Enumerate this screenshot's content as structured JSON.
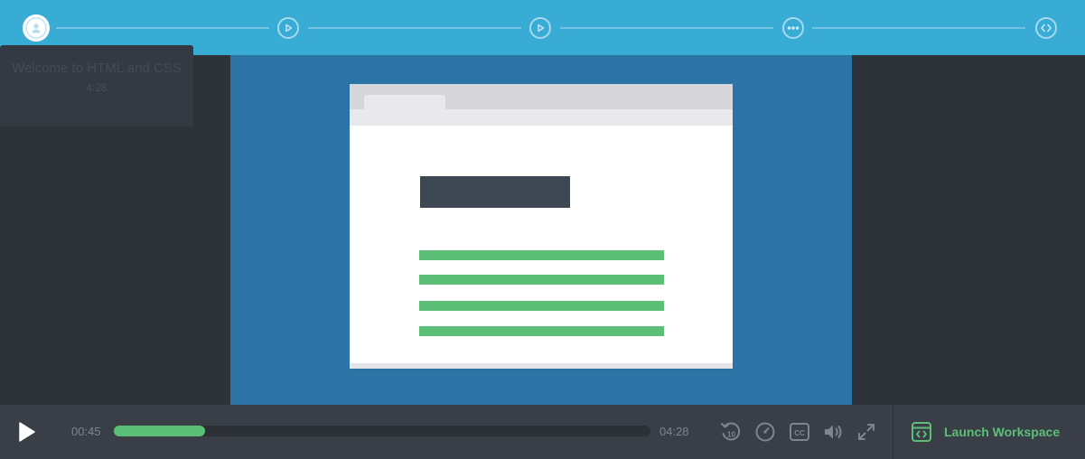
{
  "track": {
    "steps": [
      {
        "name": "step-current",
        "icon": "avatar-icon",
        "state": "current"
      },
      {
        "name": "step-video-2",
        "icon": "play-circle-icon",
        "state": "upcoming"
      },
      {
        "name": "step-video-3",
        "icon": "play-circle-icon",
        "state": "upcoming"
      },
      {
        "name": "step-quiz",
        "icon": "quiz-dots-icon",
        "state": "upcoming"
      },
      {
        "name": "step-code-challenge",
        "icon": "code-icon",
        "state": "upcoming"
      }
    ]
  },
  "tooltip": {
    "title": "Welcome to HTML and CSS",
    "meta": "4:28"
  },
  "player": {
    "current_time": "00:45",
    "duration": "04:28",
    "progress_fraction": 0.17,
    "icons": [
      "play-icon",
      "rewind-10-icon",
      "speed-gauge-icon",
      "closed-captions-icon",
      "volume-icon",
      "fullscreen-icon"
    ],
    "rewind_label": "10",
    "cc_label": "CC"
  },
  "workspace": {
    "label": "Launch Workspace",
    "icon": "workspace-icon"
  },
  "colors": {
    "track": "#39acd6",
    "video_bg": "#2c74a6",
    "accent_green": "#5bbf78",
    "control_bar": "#3a3f47",
    "page_bg": "#2e3239"
  }
}
